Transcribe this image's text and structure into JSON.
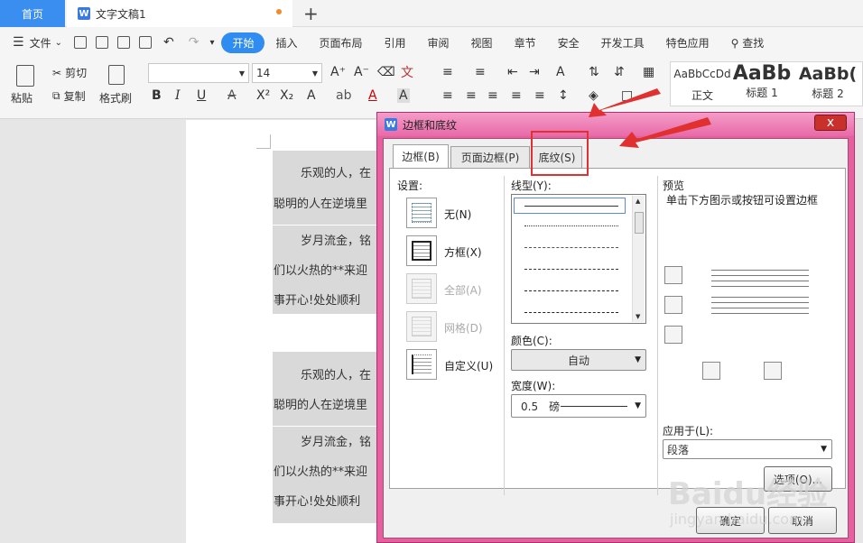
{
  "tabs": {
    "home": "首页",
    "doc": "文字文稿1",
    "new": "+"
  },
  "menu": {
    "file": "文件",
    "items": [
      "开始",
      "插入",
      "页面布局",
      "引用",
      "审阅",
      "视图",
      "章节",
      "安全",
      "开发工具",
      "特色应用"
    ],
    "search": "查找"
  },
  "ribbon": {
    "paste": "粘贴",
    "cut": "剪切",
    "copy": "复制",
    "format_painter": "格式刷",
    "font_name": "",
    "font_size": "14",
    "styles": [
      {
        "sample": "AaBbCcDd",
        "name": "正文"
      },
      {
        "sample": "AaBb",
        "name": "标题 1"
      },
      {
        "sample": "AaBb(",
        "name": "标题 2"
      }
    ]
  },
  "document": {
    "lines": [
      "乐观的人，在",
      "聪明的人在逆境里",
      "岁月流金，铭",
      "们以火热的**来迎",
      "事开心!处处顺利",
      "乐观的人，在",
      "聪明的人在逆境里",
      "岁月流金，铭",
      "们以火热的**来迎",
      "事开心!处处顺利"
    ]
  },
  "dialog": {
    "title": "边框和底纹",
    "close": "x",
    "tabs": [
      "边框(B)",
      "页面边框(P)",
      "底纹(S)"
    ],
    "setting_label": "设置:",
    "settings": [
      {
        "label": "无(N)",
        "enabled": true
      },
      {
        "label": "方框(X)",
        "enabled": true
      },
      {
        "label": "全部(A)",
        "enabled": false
      },
      {
        "label": "网格(D)",
        "enabled": false
      },
      {
        "label": "自定义(U)",
        "enabled": true
      }
    ],
    "linetype_label": "线型(Y):",
    "color_label": "颜色(C):",
    "color_value": "自动",
    "width_label": "宽度(W):",
    "width_value": "0.5　磅",
    "preview_label": "预览",
    "preview_hint": "单击下方图示或按钮可设置边框",
    "apply_label": "应用于(L):",
    "apply_value": "段落",
    "options": "选项(O)...",
    "ok": "确定",
    "cancel": "取消"
  },
  "watermark": {
    "main": "Baidu经验",
    "sub": "jingyan.baidu.com"
  },
  "colors": {
    "accent": "#2f8cf0",
    "dialog_frame": "#e85fa0",
    "highlight_box": "#e03030"
  }
}
